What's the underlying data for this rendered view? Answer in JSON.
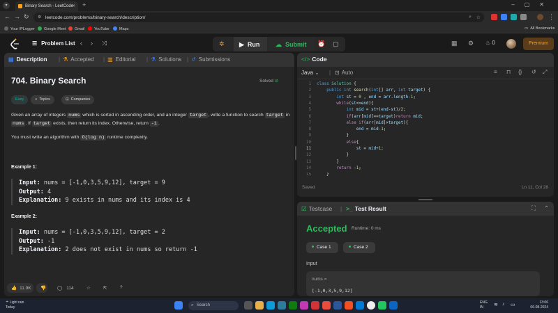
{
  "browser": {
    "tab_title": "Binary Search - LeetCode",
    "url": "leetcode.com/problems/binary-search/description/",
    "bookmarks": [
      "Your IPLogger",
      "Google Meet",
      "Gmail",
      "YouTube",
      "Maps"
    ],
    "all_bookmarks": "All Bookmarks"
  },
  "header": {
    "problem_list": "Problem List",
    "run": "Run",
    "submit": "Submit",
    "streak": "0",
    "premium": "Premium"
  },
  "left_tabs": [
    "Description",
    "Accepted",
    "Editorial",
    "Solutions",
    "Submissions"
  ],
  "problem": {
    "title": "704. Binary Search",
    "status": "Solved",
    "tags": [
      "Easy",
      "Topics",
      "Companies"
    ],
    "desc1_a": "Given an array of integers ",
    "desc1_nums": "nums",
    "desc1_b": " which is sorted in ascending order, and an integer ",
    "desc1_target": "target",
    "desc1_c": ", write a function to search ",
    "desc1_target2": "target",
    "desc1_d": " in ",
    "desc1_nums2": "nums",
    "desc1_e": ". If ",
    "desc1_target3": "target",
    "desc1_f": " exists, then return its index. Otherwise, return ",
    "desc1_neg1": "-1",
    "desc1_g": ".",
    "desc2_a": "You must write an algorithm with ",
    "desc2_code": "O(log n)",
    "desc2_b": " runtime complexity."
  },
  "examples": [
    {
      "label": "Example 1:",
      "input_lbl": "Input:",
      "input": "nums = [-1,0,3,5,9,12], target = 9",
      "output_lbl": "Output:",
      "output": "4",
      "expl_lbl": "Explanation:",
      "explanation": "9 exists in nums and its index is 4"
    },
    {
      "label": "Example 2:",
      "input_lbl": "Input:",
      "input": "nums = [-1,0,3,5,9,12], target = 2",
      "output_lbl": "Output:",
      "output": "-1",
      "expl_lbl": "Explanation:",
      "explanation": "2 does not exist in nums so return -1"
    }
  ],
  "footer": {
    "likes": "11.9K",
    "comments": "114"
  },
  "editor": {
    "title": "Code",
    "language": "Java",
    "mode": "Auto",
    "saved": "Saved",
    "cursor": "Ln 11, Col 28"
  },
  "code_lines": [
    "class Solution {",
    "    public int search(int[] arr, int target) {",
    "        int st = 0 , end = arr.length-1;",
    "        while(st<=end){",
    "            int mid = st+(end-st)/2;",
    "            if(arr[mid]==target)return mid;",
    "            else if(arr[mid]>target){",
    "                end = mid-1;",
    "            }",
    "            else{",
    "                st = mid+1;",
    "            }",
    "        }",
    "        return -1;",
    "    }"
  ],
  "result": {
    "testcase_tab": "Testcase",
    "result_tab": "Test Result",
    "status": "Accepted",
    "runtime": "Runtime: 0 ms",
    "cases": [
      "Case 1",
      "Case 2"
    ],
    "input_label": "Input",
    "param_name": "nums =",
    "param_value": "[-1,0,3,5,9,12]"
  },
  "taskbar": {
    "weather_temp": "Light rain",
    "weather_sub": "Today",
    "search": "Search",
    "lang": "ENG",
    "region": "IN",
    "time": "13:06",
    "date": "06-08-2024"
  },
  "colors": {
    "accent_green": "#2cbb5d",
    "accent_orange": "#ffa116",
    "easy": "#00b8a3"
  }
}
